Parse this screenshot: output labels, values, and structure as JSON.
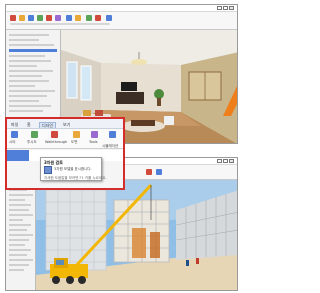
{
  "top_window": {
    "title": "",
    "scene": "interior living room rendering"
  },
  "zoom_callout": {
    "tabs": [
      "파일",
      "홈",
      "디자인",
      "보기"
    ],
    "active_tab_index": 2,
    "ribbon_labels": [
      "시야",
      "투시도",
      "Walkthrough",
      "도면",
      "Tools",
      "시뮬레이션"
    ],
    "tooltip": {
      "title": "3차원 검토",
      "description": "3차원 모델을 표시합니다.",
      "help": "자세한 도움말을 보려면 F1 키를 누르세요."
    }
  },
  "bottom_window": {
    "title": "",
    "scene": "construction site with crane and scaffolding"
  },
  "colors": {
    "callout_border": "#d42b2b",
    "accent_blue": "#4f7fd9",
    "crane_yellow": "#f2b705",
    "sky": "#8fbfe6",
    "ground": "#e7d6b6"
  }
}
